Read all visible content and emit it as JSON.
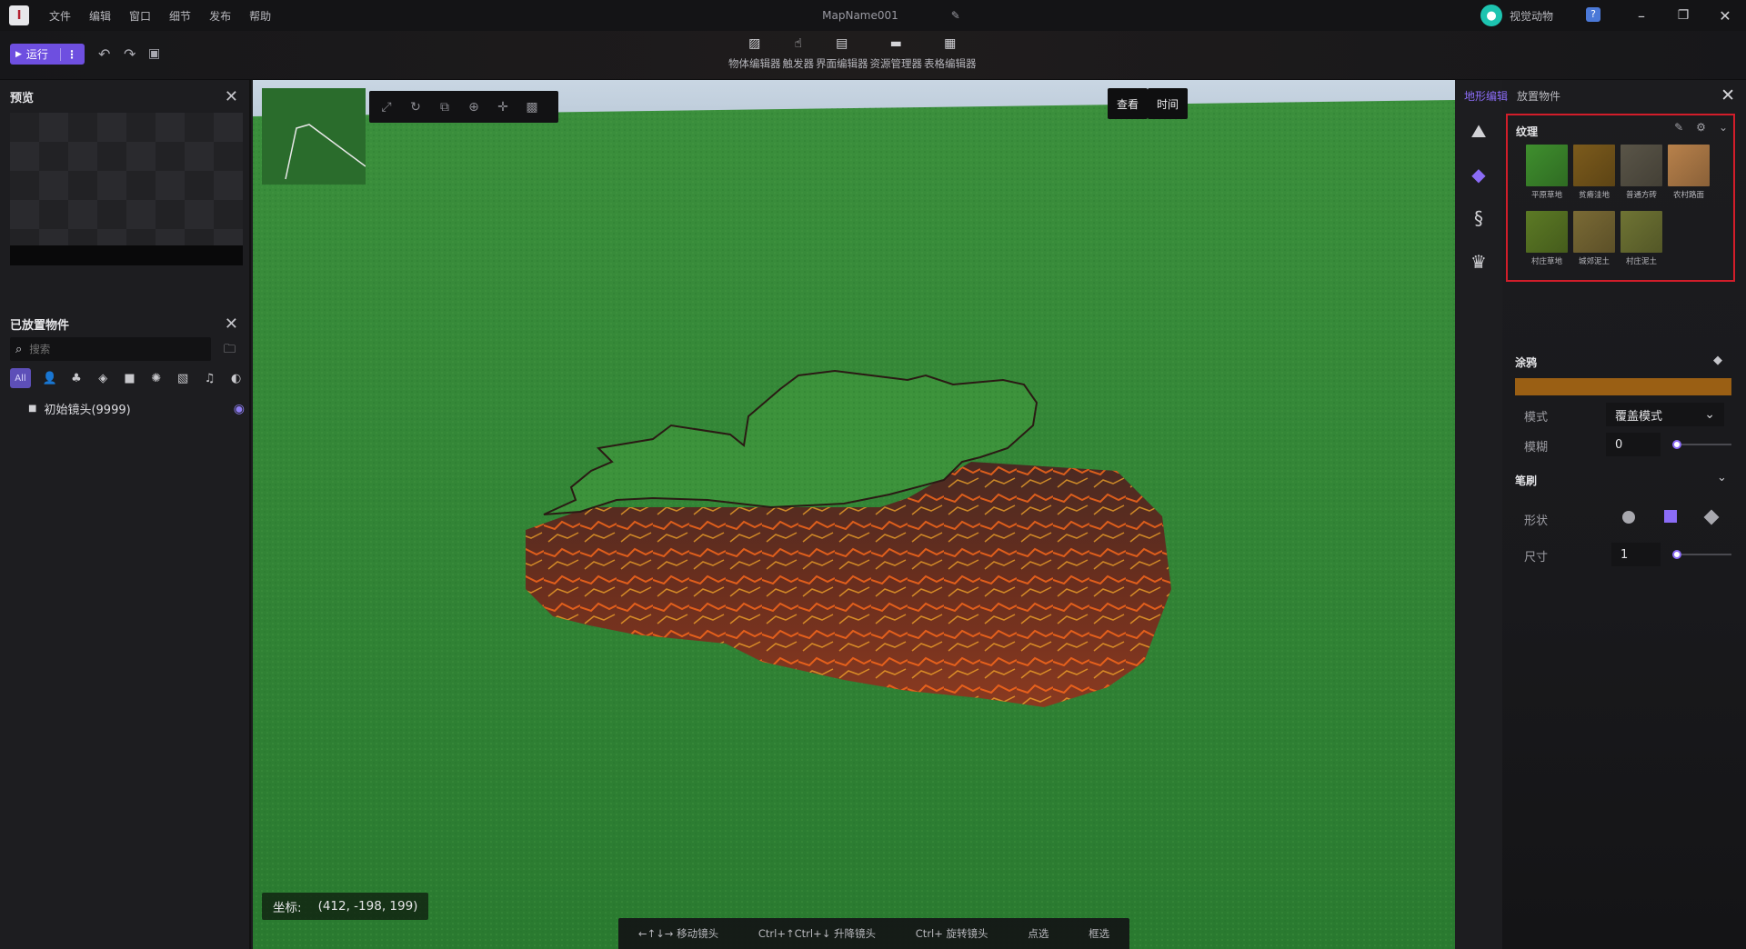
{
  "app": {
    "logo_text": "I",
    "menu": [
      "文件",
      "编辑",
      "窗口",
      "细节",
      "发布",
      "帮助"
    ],
    "map_name": "MapName001",
    "user_name": "视觉动物"
  },
  "toolbar": {
    "run_label": "运行",
    "editors": [
      {
        "label": "物体编辑器",
        "icon": "object-editor-icon"
      },
      {
        "label": "触发器",
        "icon": "trigger-icon"
      },
      {
        "label": "界面编辑器",
        "icon": "ui-editor-icon"
      },
      {
        "label": "资源管理器",
        "icon": "folder-icon"
      },
      {
        "label": "表格编辑器",
        "icon": "table-icon"
      }
    ]
  },
  "left": {
    "preview_title": "预览",
    "placed_title": "已放置物件",
    "search_placeholder": "搜索",
    "filter_all": "All",
    "tree_item": "初始镜头(9999)"
  },
  "viewport": {
    "btn_view": "查看",
    "btn_time": "时间",
    "coord_label": "坐标:",
    "coord_value": "(412, -198, 199)",
    "hints": [
      "←↑↓→ 移动镜头",
      "Ctrl+↑Ctrl+↓ 升降镜头",
      "Ctrl+ 旋转镜头",
      "点选",
      "框选"
    ]
  },
  "right": {
    "tab_terrain": "地形编辑",
    "tab_place": "放置物件",
    "texture_title": "纹理",
    "textures": [
      {
        "name": "平原草地",
        "color": "#3f8f2e"
      },
      {
        "name": "贫瘠洼地",
        "color": "#7c5b1c"
      },
      {
        "name": "普通方砖",
        "color": "#5a5548"
      },
      {
        "name": "农村路面",
        "color": "#b8814b"
      },
      {
        "name": "村庄草地",
        "color": "#5c7a25"
      },
      {
        "name": "城郊泥土",
        "color": "#7a6a35"
      },
      {
        "name": "村庄泥土",
        "color": "#6f7434"
      }
    ],
    "paint_title": "涂鸦",
    "paint_color": "#9a5f14",
    "mode_label": "模式",
    "mode_value": "覆盖模式",
    "blur_label": "模糊",
    "blur_value": "0",
    "brush_title": "笔刷",
    "shape_label": "形状",
    "size_label": "尺寸",
    "size_value": "1",
    "accent": "#8b6cf6",
    "highlight": "#d21d2a"
  }
}
